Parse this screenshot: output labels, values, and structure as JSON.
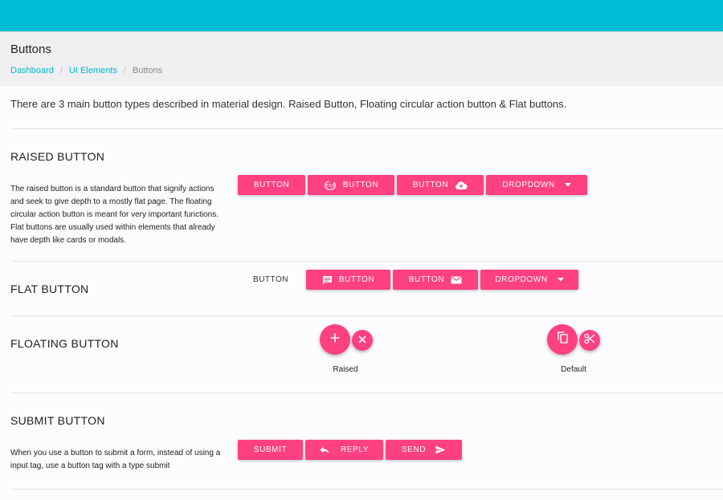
{
  "header": {
    "title": "Buttons",
    "breadcrumb": [
      "Dashboard",
      "UI Elements",
      "Buttons"
    ]
  },
  "intro": "There are 3 main button types described in material design. Raised Button, Floating circular action button & Flat buttons.",
  "raised": {
    "title": "RAISED BUTTON",
    "description": "The raised button is a standard button that signify actions and seek to give depth to a mostly flat page. The floating circular action button is meant for very important functions. Flat buttons are usually used within elements that already have depth like cards or modals.",
    "buttons": [
      {
        "label": "BUTTON"
      },
      {
        "label": "BUTTON",
        "icon": "360-icon"
      },
      {
        "label": "BUTTON",
        "icon": "cloud-upload-icon"
      },
      {
        "label": "DROPDOWN",
        "icon": "arrow-drop-down-icon"
      }
    ]
  },
  "flat": {
    "title": "FLAT BUTTON",
    "buttons": [
      {
        "label": "BUTTON"
      },
      {
        "label": "BUTTON",
        "icon": "comment-icon"
      },
      {
        "label": "BUTTON",
        "icon": "mail-icon"
      },
      {
        "label": "DROPDOWN",
        "icon": "arrow-drop-down-icon"
      }
    ]
  },
  "floating": {
    "title": "FLOATING BUTTON",
    "groups": [
      {
        "label": "Raised",
        "icons": [
          "plus-icon",
          "close-icon"
        ]
      },
      {
        "label": "Default",
        "icons": [
          "copy-icon",
          "scissors-icon"
        ]
      }
    ]
  },
  "submit": {
    "title": "SUBMIT BUTTON",
    "description": "When you use a button to submit a form, instead of using a input tag, use a button tag with a type submit",
    "buttons": [
      {
        "label": "SUBMIT"
      },
      {
        "label": "REPLY",
        "icon": "reply-icon"
      },
      {
        "label": "SEND",
        "icon": "send-icon"
      }
    ]
  },
  "colors": {
    "topbar": "#00bcd4",
    "accent": "#ff4081",
    "link": "#00bcd4"
  }
}
